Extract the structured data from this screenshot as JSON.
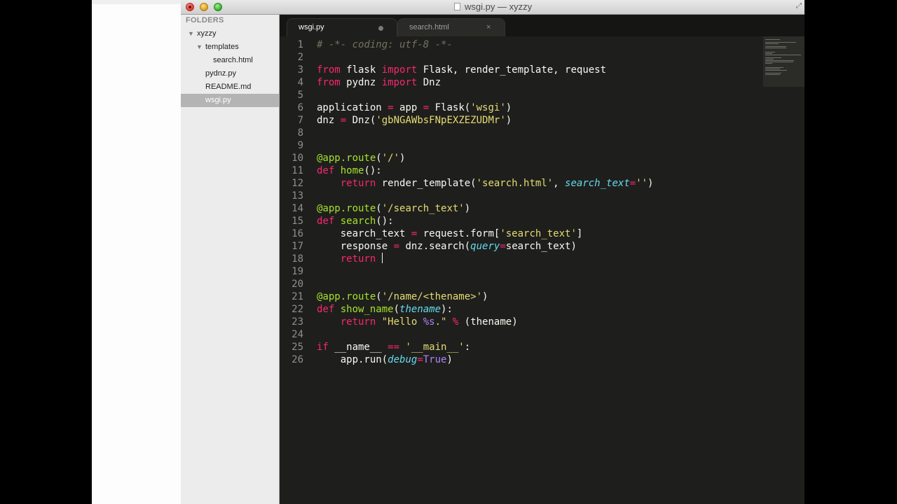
{
  "window": {
    "title": "wsgi.py — xyzzy"
  },
  "sidebar": {
    "header": "FOLDERS",
    "items": [
      {
        "label": "xyzzy",
        "kind": "folder",
        "expanded": true
      },
      {
        "label": "templates",
        "kind": "folder",
        "expanded": true
      },
      {
        "label": "search.html",
        "kind": "file"
      },
      {
        "label": "pydnz.py",
        "kind": "file"
      },
      {
        "label": "README.md",
        "kind": "file"
      },
      {
        "label": "wsgi.py",
        "kind": "file",
        "selected": true
      }
    ]
  },
  "tabs": [
    {
      "label": "wsgi.py",
      "active": true,
      "modified": true
    },
    {
      "label": "search.html",
      "active": false,
      "close_glyph": "×"
    }
  ],
  "editor": {
    "line_numbers": [
      "1",
      "2",
      "3",
      "4",
      "5",
      "6",
      "7",
      "8",
      "9",
      "10",
      "11",
      "12",
      "13",
      "14",
      "15",
      "16",
      "17",
      "18",
      "19",
      "20",
      "21",
      "22",
      "23",
      "24",
      "25",
      "26"
    ],
    "lines": [
      [
        {
          "t": "# -*- coding: utf-8 -*-",
          "c": "comment"
        }
      ],
      [],
      [
        {
          "t": "from",
          "c": "keyword"
        },
        {
          "t": " flask ",
          "c": "plain"
        },
        {
          "t": "import",
          "c": "keyword"
        },
        {
          "t": " Flask, render_template, request",
          "c": "plain"
        }
      ],
      [
        {
          "t": "from",
          "c": "keyword"
        },
        {
          "t": " pydnz ",
          "c": "plain"
        },
        {
          "t": "import",
          "c": "keyword"
        },
        {
          "t": " Dnz",
          "c": "plain"
        }
      ],
      [],
      [
        {
          "t": "application ",
          "c": "plain"
        },
        {
          "t": "=",
          "c": "keyword"
        },
        {
          "t": " app ",
          "c": "plain"
        },
        {
          "t": "=",
          "c": "keyword"
        },
        {
          "t": " Flask(",
          "c": "plain"
        },
        {
          "t": "'wsgi'",
          "c": "string"
        },
        {
          "t": ")",
          "c": "plain"
        }
      ],
      [
        {
          "t": "dnz ",
          "c": "plain"
        },
        {
          "t": "=",
          "c": "keyword"
        },
        {
          "t": " Dnz(",
          "c": "plain"
        },
        {
          "t": "'gbNGAWbsFNpEXZEZUDMr'",
          "c": "string"
        },
        {
          "t": ")",
          "c": "plain"
        }
      ],
      [],
      [],
      [
        {
          "t": "@app.route",
          "c": "deco"
        },
        {
          "t": "(",
          "c": "plain"
        },
        {
          "t": "'/'",
          "c": "string"
        },
        {
          "t": ")",
          "c": "plain"
        }
      ],
      [
        {
          "t": "def",
          "c": "keyword"
        },
        {
          "t": " ",
          "c": "plain"
        },
        {
          "t": "home",
          "c": "func"
        },
        {
          "t": "():",
          "c": "plain"
        }
      ],
      [
        {
          "t": "    ",
          "c": "plain"
        },
        {
          "t": "return",
          "c": "keyword"
        },
        {
          "t": " render_template(",
          "c": "plain"
        },
        {
          "t": "'search.html'",
          "c": "string"
        },
        {
          "t": ", ",
          "c": "plain"
        },
        {
          "t": "search_text",
          "c": "param"
        },
        {
          "t": "=",
          "c": "keyword"
        },
        {
          "t": "''",
          "c": "string"
        },
        {
          "t": ")",
          "c": "plain"
        }
      ],
      [],
      [
        {
          "t": "@app.route",
          "c": "deco"
        },
        {
          "t": "(",
          "c": "plain"
        },
        {
          "t": "'/search_text'",
          "c": "string"
        },
        {
          "t": ")",
          "c": "plain"
        }
      ],
      [
        {
          "t": "def",
          "c": "keyword"
        },
        {
          "t": " ",
          "c": "plain"
        },
        {
          "t": "search",
          "c": "func"
        },
        {
          "t": "():",
          "c": "plain"
        }
      ],
      [
        {
          "t": "    search_text ",
          "c": "plain"
        },
        {
          "t": "=",
          "c": "keyword"
        },
        {
          "t": " request.form[",
          "c": "plain"
        },
        {
          "t": "'search_text'",
          "c": "string"
        },
        {
          "t": "]",
          "c": "plain"
        }
      ],
      [
        {
          "t": "    response ",
          "c": "plain"
        },
        {
          "t": "=",
          "c": "keyword"
        },
        {
          "t": " dnz.search(",
          "c": "plain"
        },
        {
          "t": "query",
          "c": "param"
        },
        {
          "t": "=",
          "c": "keyword"
        },
        {
          "t": "search_text)",
          "c": "plain"
        }
      ],
      [
        {
          "t": "    ",
          "c": "plain"
        },
        {
          "t": "return",
          "c": "keyword"
        },
        {
          "t": " ",
          "c": "plain"
        },
        {
          "t": "",
          "c": "cursor"
        }
      ],
      [],
      [],
      [
        {
          "t": "@app.route",
          "c": "deco"
        },
        {
          "t": "(",
          "c": "plain"
        },
        {
          "t": "'/name/<thename>'",
          "c": "string"
        },
        {
          "t": ")",
          "c": "plain"
        }
      ],
      [
        {
          "t": "def",
          "c": "keyword"
        },
        {
          "t": " ",
          "c": "plain"
        },
        {
          "t": "show_name",
          "c": "func"
        },
        {
          "t": "(",
          "c": "plain"
        },
        {
          "t": "thename",
          "c": "param"
        },
        {
          "t": "):",
          "c": "plain"
        }
      ],
      [
        {
          "t": "    ",
          "c": "plain"
        },
        {
          "t": "return",
          "c": "keyword"
        },
        {
          "t": " ",
          "c": "plain"
        },
        {
          "t": "\"Hello ",
          "c": "string"
        },
        {
          "t": "%s",
          "c": "const"
        },
        {
          "t": ".\"",
          "c": "string"
        },
        {
          "t": " ",
          "c": "plain"
        },
        {
          "t": "%",
          "c": "keyword"
        },
        {
          "t": " (thename)",
          "c": "plain"
        }
      ],
      [],
      [
        {
          "t": "if",
          "c": "keyword"
        },
        {
          "t": " __name__ ",
          "c": "plain"
        },
        {
          "t": "==",
          "c": "keyword"
        },
        {
          "t": " ",
          "c": "plain"
        },
        {
          "t": "'__main__'",
          "c": "string"
        },
        {
          "t": ":",
          "c": "plain"
        }
      ],
      [
        {
          "t": "    app.run(",
          "c": "plain"
        },
        {
          "t": "debug",
          "c": "param"
        },
        {
          "t": "=",
          "c": "keyword"
        },
        {
          "t": "True",
          "c": "const"
        },
        {
          "t": ")",
          "c": "plain"
        }
      ]
    ]
  },
  "colors": {
    "background": "#1e1f1c",
    "keyword": "#f92672",
    "string": "#e6db74",
    "function": "#a6e22e",
    "parameter": "#66d9ef",
    "constant": "#ae81ff",
    "comment": "#75715e"
  }
}
